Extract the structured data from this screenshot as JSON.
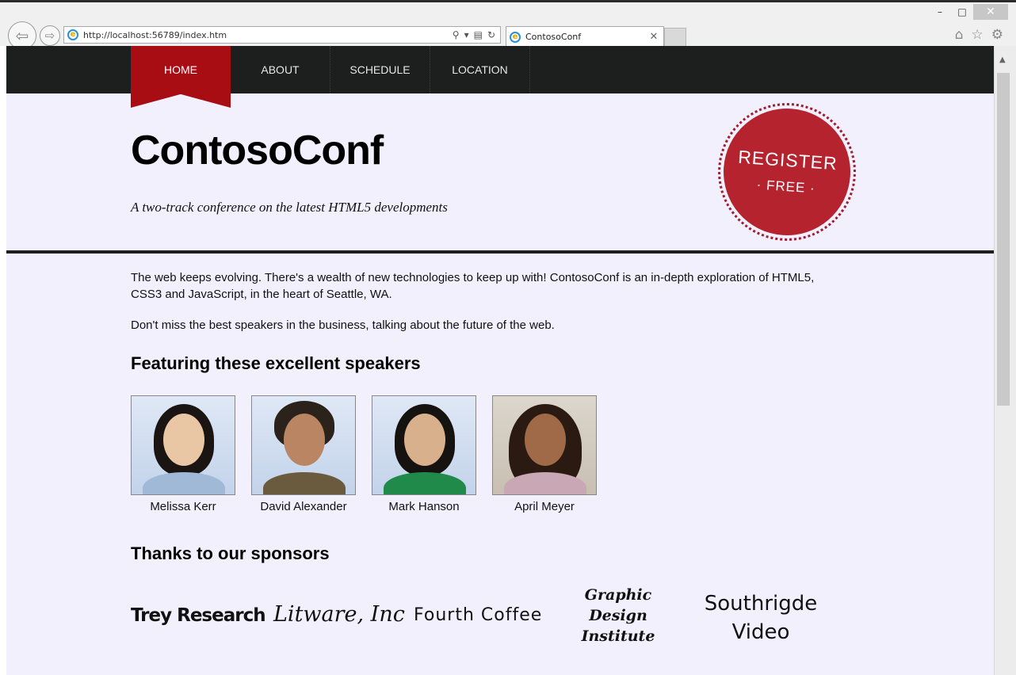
{
  "browser": {
    "url": "http://localhost:56789/index.htm",
    "tab_title": "ContosoConf",
    "win_minimize": "–",
    "win_maximize": "□",
    "win_close": "✕",
    "icons": [
      "back-arrow-icon",
      "forward-arrow-icon",
      "ie-logo-icon",
      "search-icon",
      "compat-view-icon",
      "refresh-icon",
      "close-icon",
      "home-icon",
      "favorites-star-icon",
      "settings-gear-icon"
    ]
  },
  "nav": {
    "items": [
      {
        "label": "HOME",
        "active": true
      },
      {
        "label": "ABOUT",
        "active": false
      },
      {
        "label": "SCHEDULE",
        "active": false
      },
      {
        "label": "LOCATION",
        "active": false
      }
    ]
  },
  "header": {
    "title": "ContosoConf",
    "tagline": "A two-track conference on the latest HTML5 developments",
    "register_main": "REGISTER",
    "register_sub": "· FREE ·"
  },
  "content": {
    "intro": "The web keeps evolving. There's a wealth of new technologies to keep up with! ContosoConf is an in-depth exploration of HTML5, CSS3 and JavaScript, in the heart of Seattle, WA.",
    "intro2": "Don't miss the best speakers in the business, talking about the future of the web.",
    "speakers_heading": "Featuring these excellent speakers",
    "speakers": [
      {
        "name": "Melissa Kerr"
      },
      {
        "name": "David Alexander"
      },
      {
        "name": "Mark Hanson"
      },
      {
        "name": "April Meyer"
      }
    ],
    "sponsors_heading": "Thanks to our sponsors",
    "sponsors": [
      "Trey Research",
      "Litware, Inc",
      "Fourth Coffee",
      "Graphic Design Institute",
      "Southrigde Video"
    ]
  },
  "colors": {
    "nav_bg": "#1c1f1e",
    "accent_red": "#a90d14",
    "page_bg": "#f2f0fd"
  }
}
